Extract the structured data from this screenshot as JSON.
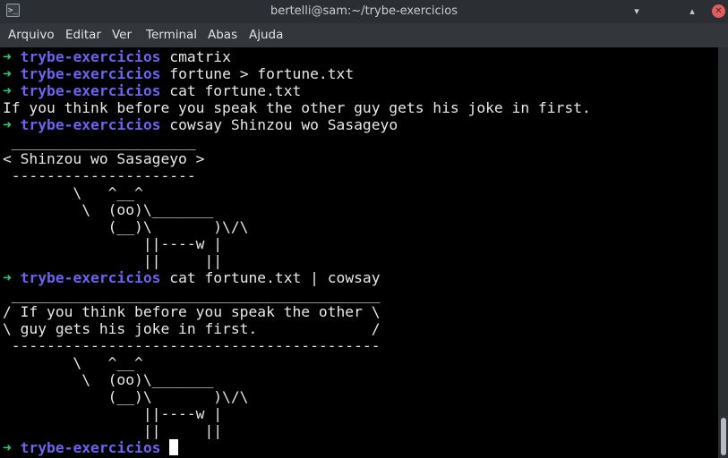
{
  "window": {
    "title": "bertelli@sam:~/trybe-exercicios",
    "app_icon_glyph": ">_",
    "buttons": {
      "minimize_glyph": "▾",
      "maximize_glyph": "▴",
      "close_glyph": "✕"
    }
  },
  "menu": {
    "items": [
      "Arquivo",
      "Editar",
      "Ver",
      "Terminal",
      "Abas",
      "Ajuda"
    ]
  },
  "terminal": {
    "prompt": {
      "arrow": "➜",
      "dir": "trybe-exercicios"
    },
    "lines": [
      {
        "type": "prompt",
        "cmd": "cmatrix"
      },
      {
        "type": "prompt",
        "cmd": "fortune > fortune.txt"
      },
      {
        "type": "prompt",
        "cmd": "cat fortune.txt"
      },
      {
        "type": "output",
        "text": "If you think before you speak the other guy gets his joke in first."
      },
      {
        "type": "prompt",
        "cmd": "cowsay Shinzou wo Sasageyo"
      },
      {
        "type": "output",
        "text": " _____________________"
      },
      {
        "type": "output",
        "text": "< Shinzou wo Sasageyo >"
      },
      {
        "type": "output",
        "text": " ---------------------"
      },
      {
        "type": "output",
        "text": "        \\   ^__^"
      },
      {
        "type": "output",
        "text": "         \\  (oo)\\_______"
      },
      {
        "type": "output",
        "text": "            (__)\\       )\\/\\"
      },
      {
        "type": "output",
        "text": "                ||----w |"
      },
      {
        "type": "output",
        "text": "                ||     ||"
      },
      {
        "type": "prompt",
        "cmd": "cat fortune.txt | cowsay"
      },
      {
        "type": "output",
        "text": " __________________________________________"
      },
      {
        "type": "output",
        "text": "/ If you think before you speak the other \\"
      },
      {
        "type": "output",
        "text": "\\ guy gets his joke in first.             /"
      },
      {
        "type": "output",
        "text": " ------------------------------------------"
      },
      {
        "type": "output",
        "text": "        \\   ^__^"
      },
      {
        "type": "output",
        "text": "         \\  (oo)\\_______"
      },
      {
        "type": "output",
        "text": "            (__)\\       )\\/\\"
      },
      {
        "type": "output",
        "text": "                ||----w |"
      },
      {
        "type": "output",
        "text": "                ||     ||"
      },
      {
        "type": "prompt",
        "cmd": "",
        "cursor": true
      }
    ]
  },
  "colors": {
    "prompt_arrow": "#2ecc71",
    "prompt_dir": "#6c63f0",
    "close_button": "#e35d5d"
  }
}
